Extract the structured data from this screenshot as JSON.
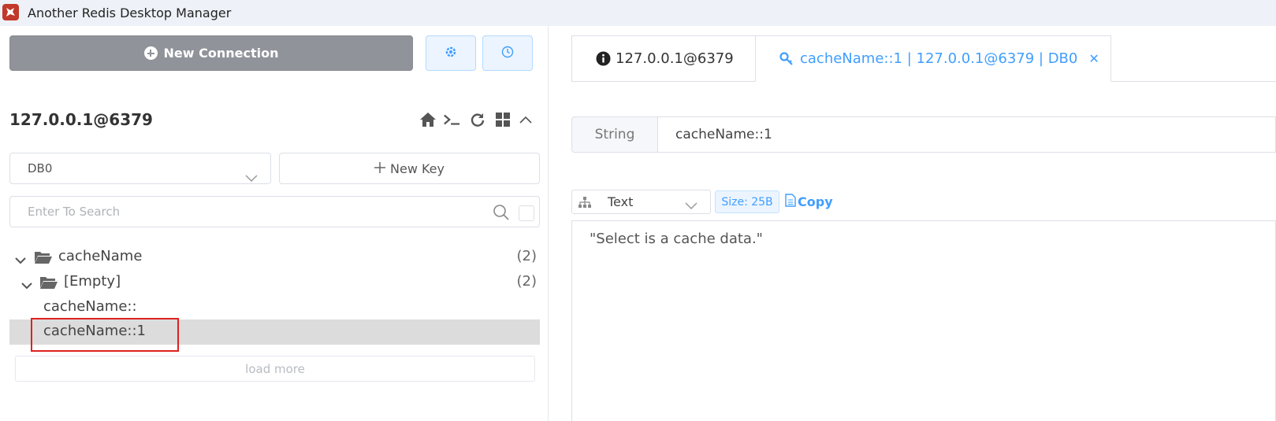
{
  "window": {
    "title": "Another Redis Desktop Manager",
    "icon": "redis-app-icon"
  },
  "toolbar": {
    "new_connection_label": "New Connection",
    "settings_icon": "gear-icon",
    "history_icon": "clock-icon"
  },
  "connection": {
    "title": "127.0.0.1@6379",
    "tools": [
      "home-icon",
      "terminal-icon",
      "refresh-icon",
      "grid-icon",
      "chevron-up-icon"
    ],
    "db_select": "DB0",
    "new_key_label": "New Key",
    "search": {
      "placeholder": "Enter To Search",
      "value": ""
    }
  },
  "tree": {
    "items": [
      {
        "label": "cacheName",
        "count": "(2)",
        "type": "folder"
      },
      {
        "label": "[Empty]",
        "count": "(2)",
        "type": "folder"
      },
      {
        "label": "cacheName::",
        "type": "key"
      },
      {
        "label": "cacheName::1",
        "type": "key",
        "selected": true
      }
    ],
    "load_more_label": "load more"
  },
  "tabs": [
    {
      "label": "127.0.0.1@6379",
      "icon": "info-icon",
      "active": false
    },
    {
      "label": "cacheName::1 | 127.0.0.1@6379 | DB0",
      "icon": "key-icon",
      "active": true,
      "closable": true
    }
  ],
  "key_detail": {
    "type": "String",
    "key_name": "cacheName::1",
    "format": "Text",
    "size_label": "Size: 25B",
    "copy_label": "Copy",
    "value": "\"Select is a cache data.\""
  },
  "colors": {
    "accent": "#409eff",
    "primary_button": "#909399",
    "selected_row": "#dcdcdc",
    "highlight_box": "#e02020"
  }
}
